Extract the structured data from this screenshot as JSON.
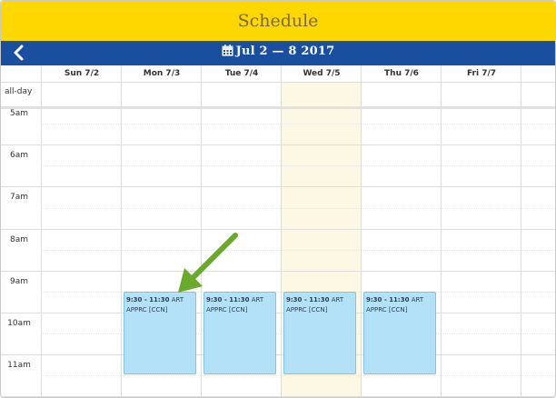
{
  "header": {
    "title": "Schedule"
  },
  "nav": {
    "date_range": "Jul 2 — 8 2017"
  },
  "days": [
    {
      "label": "Sun 7/2"
    },
    {
      "label": "Mon 7/3"
    },
    {
      "label": "Tue 7/4"
    },
    {
      "label": "Wed 7/5"
    },
    {
      "label": "Thu 7/6"
    },
    {
      "label": "Fri 7/7"
    }
  ],
  "allday_label": "all-day",
  "times": [
    "5am",
    "6am",
    "7am",
    "8am",
    "9am",
    "10am",
    "11am"
  ],
  "events": [
    {
      "time": "9:30 - 11:30",
      "title": "ART APPRC [CCN]"
    },
    {
      "time": "9:30 - 11:30",
      "title": "ART APPRC [CCN]"
    },
    {
      "time": "9:30 - 11:30",
      "title": "ART APPRC [CCN]"
    },
    {
      "time": "9:30 - 11:30",
      "title": "ART APPRC [CCN]"
    }
  ],
  "colors": {
    "header_bg": "#ffd800",
    "nav_bg": "#1a4fa0",
    "event_bg": "#b3e2f8",
    "today_bg": "#fcf8e3",
    "arrow": "#6aaa2a"
  }
}
